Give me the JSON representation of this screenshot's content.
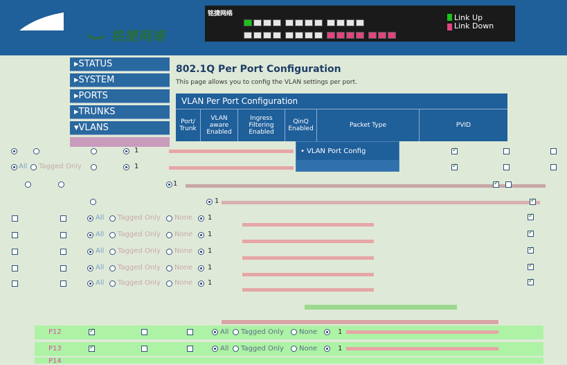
{
  "header": {
    "brand_text": "铭捷网络",
    "device_logo": "铭捷网络",
    "legend_link_up": "Link Up",
    "legend_link_down": "Link Down",
    "link_up_color": "#19c419",
    "link_down_color": "#e0457f"
  },
  "nav": {
    "items": [
      {
        "label": "▸STATUS"
      },
      {
        "label": "▸SYSTEM"
      },
      {
        "label": "▸PORTS"
      },
      {
        "label": "▸TRUNKS"
      },
      {
        "label": "▾VLANS"
      }
    ]
  },
  "main": {
    "title": "802.1Q Per Port Configuration",
    "description": "This page allows you to config the VLAN settings per port.",
    "table_title": "VLAN Per Port Configuration",
    "columns": [
      "Port/ Trunk",
      "VLAN aware Enabled",
      "Ingress Filtering Enabled",
      "QinQ Enabled",
      "Packet Type",
      "PVID"
    ]
  },
  "popup": {
    "item": "• VLAN Port Config"
  },
  "options": {
    "all": "All",
    "tagged_only": "Tagged Only",
    "none": "None",
    "pvid": "1"
  },
  "rows": [
    {
      "port": "P12"
    },
    {
      "port": "P13"
    },
    {
      "port": "P14"
    }
  ]
}
